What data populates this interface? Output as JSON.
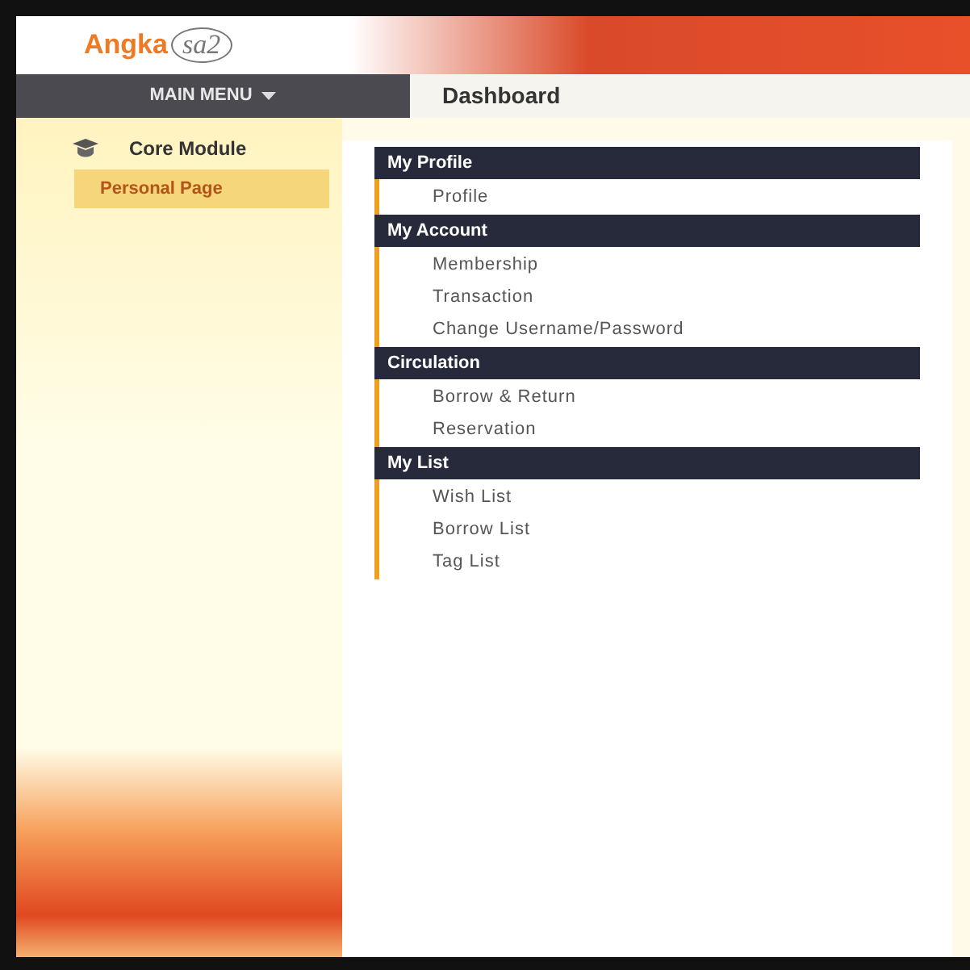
{
  "logo": {
    "word": "Angka",
    "mark": "sa2"
  },
  "main_menu": {
    "label": "MAIN MENU"
  },
  "page_title": "Dashboard",
  "sidebar": {
    "module": "Core Module",
    "items": [
      {
        "label": "Personal Page",
        "selected": true
      }
    ]
  },
  "sections": [
    {
      "title": "My Profile",
      "items": [
        "Profile"
      ]
    },
    {
      "title": "My Account",
      "items": [
        "Membership",
        "Transaction",
        "Change Username/Password"
      ]
    },
    {
      "title": "Circulation",
      "items": [
        "Borrow & Return",
        "Reservation"
      ]
    },
    {
      "title": "My List",
      "items": [
        "Wish List",
        "Borrow List",
        "Tag List"
      ]
    }
  ]
}
